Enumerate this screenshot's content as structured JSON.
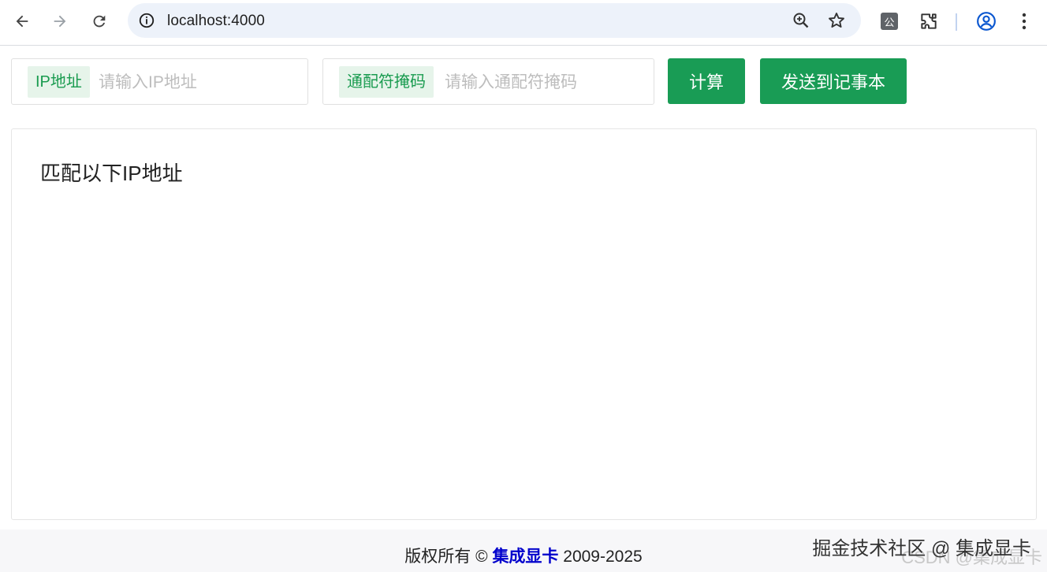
{
  "browser": {
    "url": "localhost:4000",
    "extension_label": "公"
  },
  "form": {
    "ip_tag": "IP地址",
    "ip_placeholder": "请输入IP地址",
    "ip_value": "",
    "mask_tag": "通配符掩码",
    "mask_placeholder": "请输入通配符掩码",
    "mask_value": "",
    "calculate_label": "计算",
    "send_label": "发送到记事本"
  },
  "result": {
    "title": "匹配以下IP地址"
  },
  "footer": {
    "prefix": "版权所有 © ",
    "brand": "集成显卡",
    "years": " 2009-2025"
  },
  "watermark": {
    "line1": "掘金技术社区 @ 集成显卡",
    "line2": "CSDN @集成显卡"
  },
  "colors": {
    "accent": "#199c55",
    "tag_bg": "#e6f4ea",
    "brand_link": "#0000cc"
  }
}
